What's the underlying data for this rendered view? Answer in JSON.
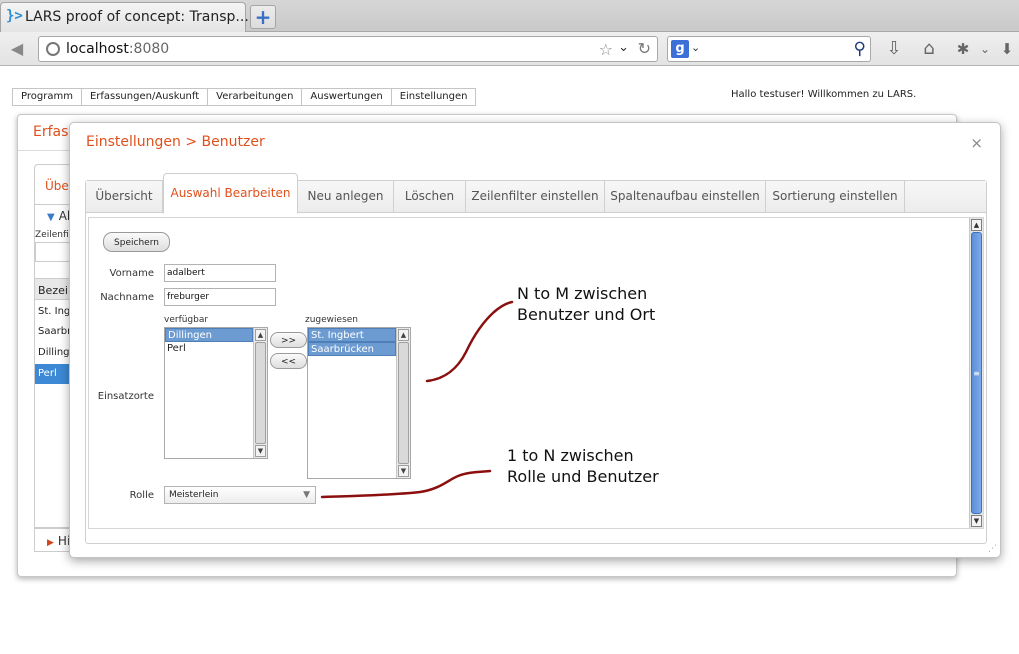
{
  "browser": {
    "tab_title": "LARS proof of concept: Transp...",
    "tab_icon": "}>",
    "new_tab_label": "+",
    "url_host": "localhost",
    "url_port": ":8080",
    "search_engine_label": "g"
  },
  "menu": {
    "items": [
      "Programm",
      "Erfassungen/Auskunft",
      "Verarbeitungen",
      "Auswertungen",
      "Einstellungen"
    ]
  },
  "welcome": "Hallo testuser! Willkommen zu LARS.",
  "background_window": {
    "title": "Erfass",
    "tab": "Übe",
    "accordion": "Al",
    "filter_label": "Zeilenfil",
    "column_header": "Bezei",
    "rows": [
      "St. Ingb",
      "Saarbr",
      "Dillinge",
      "Perl"
    ],
    "selected_row": "Perl",
    "footer": "Hi"
  },
  "dialog": {
    "title": "Einstellungen > Benutzer",
    "close_label": "×",
    "tabs": [
      {
        "label": "Übersicht",
        "active": false
      },
      {
        "label": "Auswahl Bearbeiten",
        "active": true
      },
      {
        "label": "Neu anlegen",
        "active": false
      },
      {
        "label": "Löschen",
        "active": false
      },
      {
        "label": "Zeilenfilter einstellen",
        "active": false
      },
      {
        "label": "Spaltenaufbau einstellen",
        "active": false
      },
      {
        "label": "Sortierung einstellen",
        "active": false
      }
    ],
    "form": {
      "save_label": "Speichern",
      "vorname_label": "Vorname",
      "vorname_value": "adalbert",
      "nachname_label": "Nachname",
      "nachname_value": "freburger",
      "einsatzorte_label": "Einsatzorte",
      "available_label": "verfügbar",
      "available_items": [
        {
          "text": "Dillingen",
          "selected": true
        },
        {
          "text": "Perl",
          "selected": false
        }
      ],
      "assigned_label": "zugewiesen",
      "assigned_items": [
        {
          "text": "St. Ingbert",
          "selected": true
        },
        {
          "text": "Saarbrücken",
          "selected": true
        }
      ],
      "add_label": ">>",
      "remove_label": "<<",
      "rolle_label": "Rolle",
      "rolle_value": "Meisterlein"
    }
  },
  "annotations": {
    "nm_line1": "N to M zwischen",
    "nm_line2": "Benutzer und Ort",
    "n1_line1": "1 to N zwischen",
    "n1_line2": "Rolle und Benutzer"
  },
  "colors": {
    "accent": "#e0501c",
    "selection": "#6c9bd1",
    "annotation_stroke": "#8b0f0f"
  }
}
